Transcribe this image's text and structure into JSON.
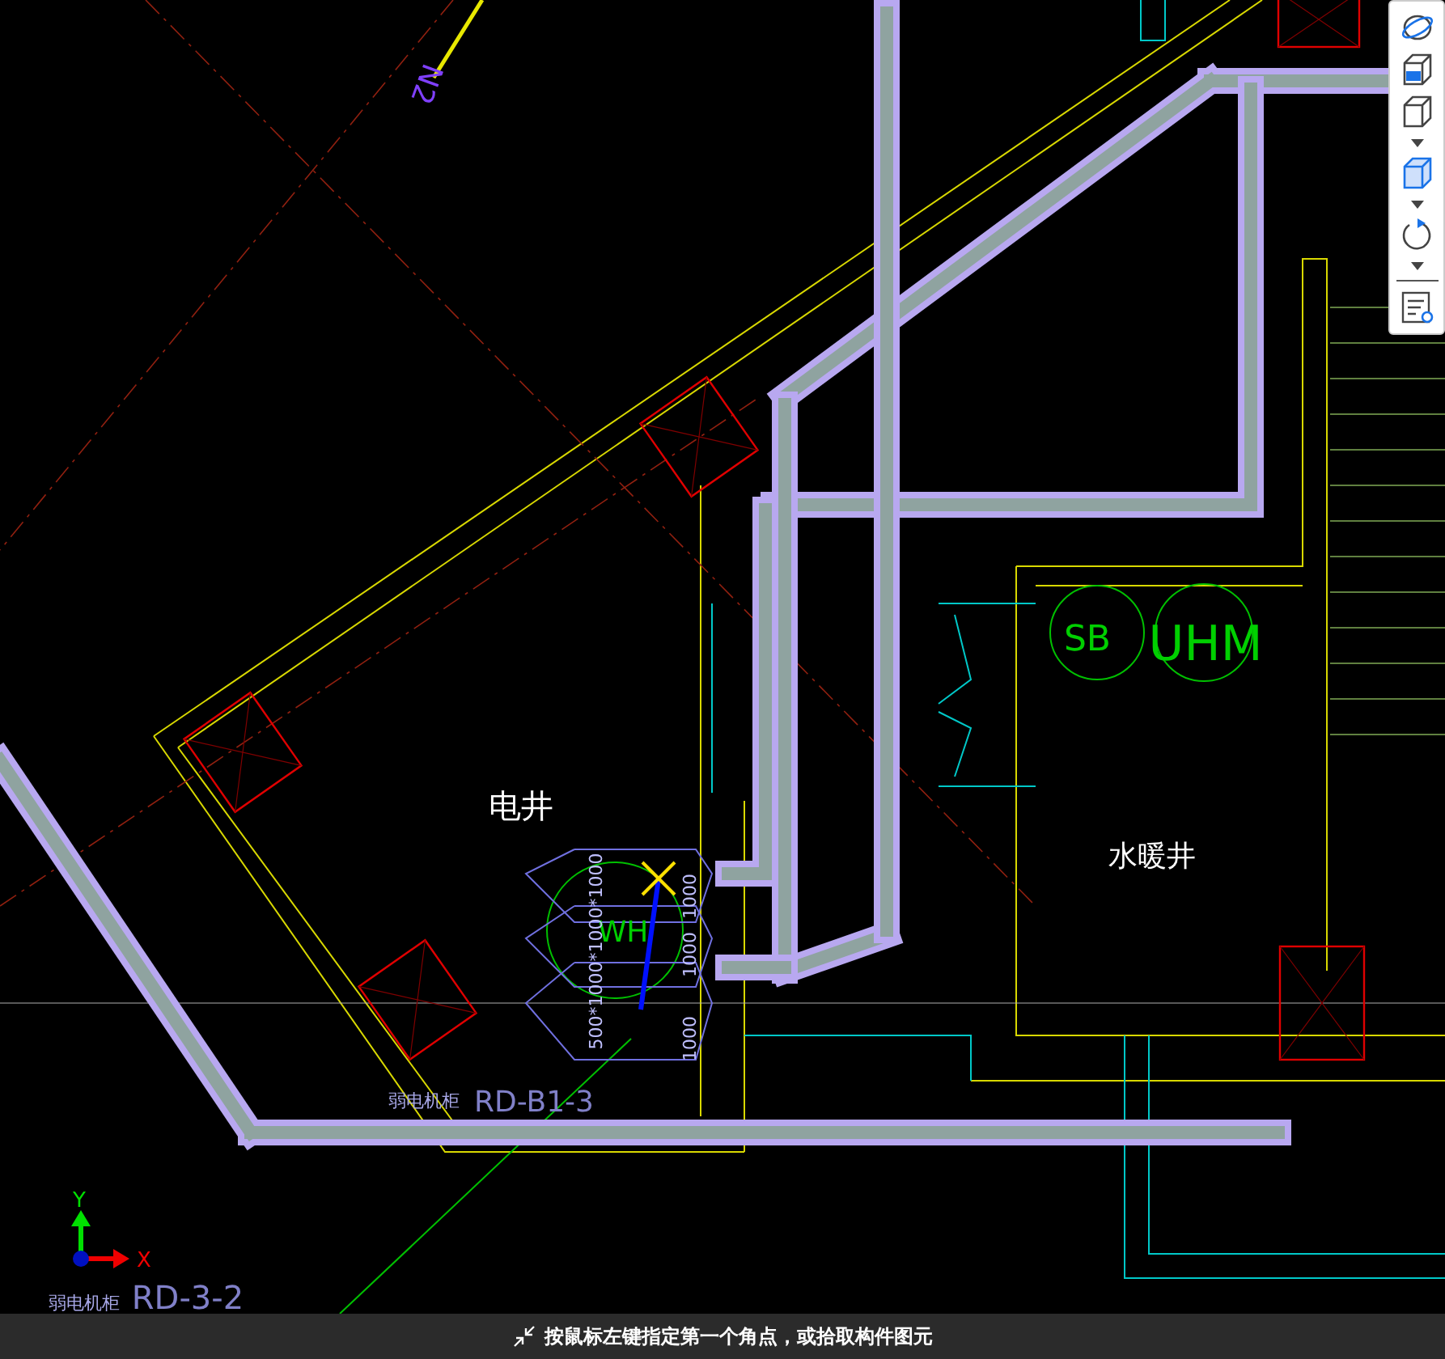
{
  "drawing": {
    "labels": [
      {
        "kind": "tag",
        "text": "N2"
      },
      {
        "kind": "room",
        "text": "电井"
      },
      {
        "kind": "equipment",
        "text": "SB"
      },
      {
        "kind": "equipment",
        "text": "UHM"
      },
      {
        "kind": "room",
        "text": "水暖井"
      },
      {
        "kind": "equipment",
        "text": "WH"
      },
      {
        "kind": "dimension",
        "text": "500*1000*1000*1000"
      },
      {
        "kind": "dimension",
        "text": "1000"
      },
      {
        "kind": "dimension",
        "text": "1000"
      },
      {
        "kind": "dimension",
        "text": "1000"
      },
      {
        "kind": "cabinet",
        "text": "弱电机柜"
      },
      {
        "kind": "cabinet-id",
        "text": "RD-B1-3"
      },
      {
        "kind": "cabinet",
        "text": "弱电机柜"
      },
      {
        "kind": "cabinet-id",
        "text": "RD-3-2"
      }
    ]
  },
  "axes": {
    "y": "Y",
    "x": "X"
  },
  "status_bar": {
    "prompt": "按鼠标左键指定第一个角点，或拾取构件图元"
  }
}
